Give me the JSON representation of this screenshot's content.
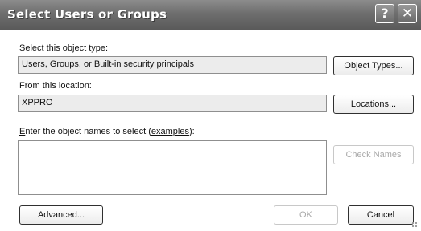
{
  "window": {
    "title": "Select Users or Groups",
    "help_label": "?",
    "close_label": "✕"
  },
  "object_type": {
    "label": "Select this object type:",
    "value": "Users, Groups, or Built-in security principals",
    "button_label": "Object Types..."
  },
  "location": {
    "label": "From this location:",
    "value": "XPPRO",
    "button_label": "Locations..."
  },
  "names": {
    "label_prefix_underlined": "E",
    "label_text": "nter the object names to select (",
    "label_link": "examples",
    "label_suffix": "):",
    "value": "",
    "check_names_label": "Check Names"
  },
  "footer": {
    "advanced_label": "Advanced...",
    "ok_label": "OK",
    "cancel_label": "Cancel"
  },
  "colors": {
    "titlebar": "#6e6e6e",
    "field_bg": "#ececec",
    "disabled_text": "#a9a9a9"
  }
}
